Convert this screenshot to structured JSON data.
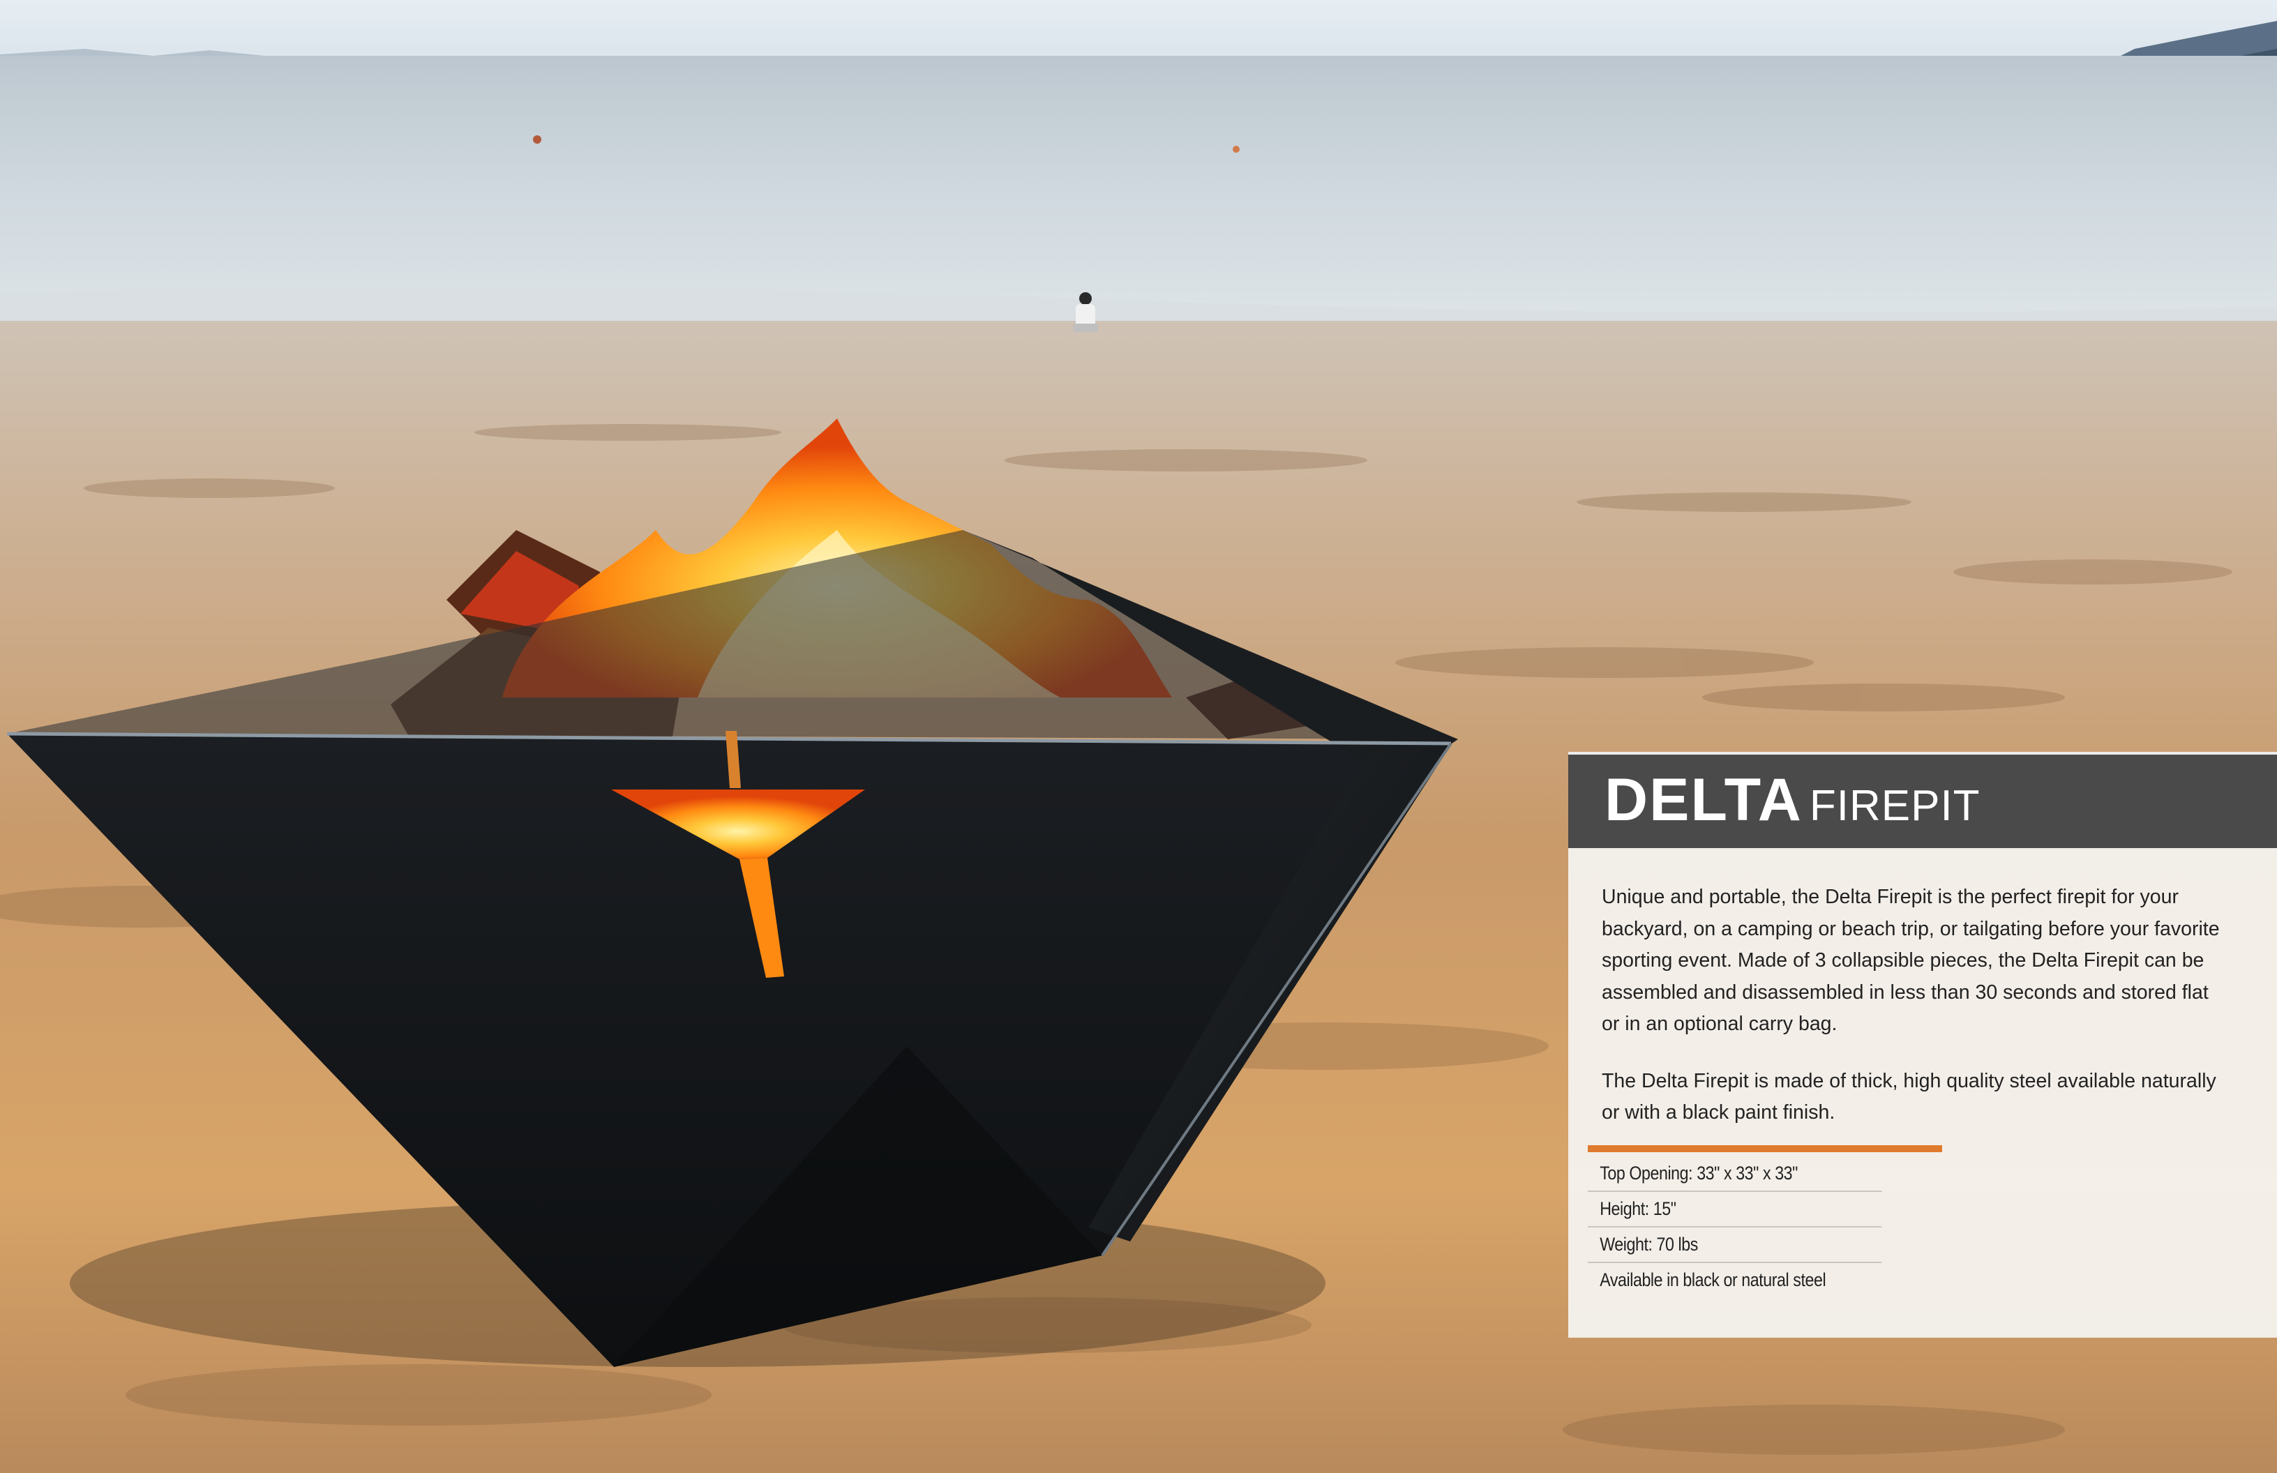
{
  "product": {
    "name_bold": "DELTA",
    "name_light": "FIREPIT"
  },
  "description": {
    "paragraph_1": "Unique and portable, the Delta Firepit is the perfect firepit for your backyard, on a camping or beach trip, or tailgating before your favorite sporting event. Made of 3 collapsible pieces, the Delta Firepit can be assembled and disassembled in less than 30 seconds and stored flat or in an optional carry bag.",
    "paragraph_2": "The Delta Firepit is made of thick, high quality steel available naturally or with a black paint finish."
  },
  "specs": [
    "Top Opening: 33\" x 33\" x 33\"",
    "Height: 15\"",
    "Weight: 70 lbs",
    "Available in black or natural steel"
  ],
  "colors": {
    "title_bar": "#4a4a4a",
    "accent_rule": "#e07a2e",
    "panel_bg": "#f5f4f2",
    "sand": "#d9a66e",
    "sea": "#c9d3da",
    "firepit": "#121416"
  }
}
